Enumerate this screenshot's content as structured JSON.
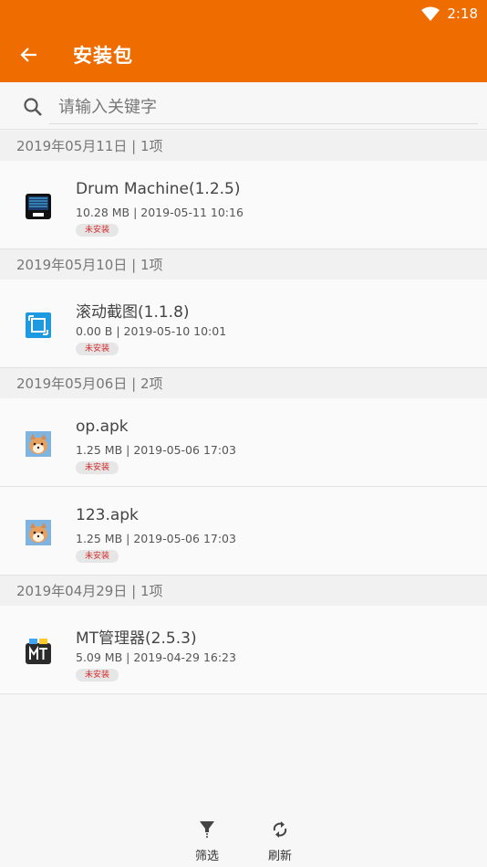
{
  "status": {
    "time": "2:18"
  },
  "toolbar": {
    "title": "安装包"
  },
  "search": {
    "placeholder": "请输入关键字",
    "value": ""
  },
  "groups": [
    {
      "header": "2019年05月11日 | 1项",
      "items": [
        {
          "name": "Drum Machine(1.2.5)",
          "meta": "10.28 MB | 2019-05-11 10:16",
          "badge": "未安装",
          "icon": "drum-machine-app-icon"
        }
      ]
    },
    {
      "header": "2019年05月10日 | 1项",
      "items": [
        {
          "name": "滚动截图(1.1.8)",
          "meta": "0.00 B | 2019-05-10 10:01",
          "badge": "未安装",
          "icon": "scroll-screenshot-app-icon"
        }
      ]
    },
    {
      "header": "2019年05月06日 | 2项",
      "items": [
        {
          "name": "op.apk",
          "meta": "1.25 MB | 2019-05-06 17:03",
          "badge": "未安装",
          "icon": "shiba-dog-app-icon"
        },
        {
          "name": "123.apk",
          "meta": "1.25 MB | 2019-05-06 17:03",
          "badge": "未安装",
          "icon": "shiba-dog-app-icon"
        }
      ]
    },
    {
      "header": "2019年04月29日 | 1项",
      "items": [
        {
          "name": "MT管理器(2.5.3)",
          "meta": "5.09 MB | 2019-04-29 16:23",
          "badge": "未安装",
          "icon": "mt-manager-app-icon"
        }
      ]
    }
  ],
  "bottom": {
    "filter_label": "筛选",
    "refresh_label": "刷新"
  },
  "colors": {
    "accent": "#ef6c00",
    "badge_text": "#d32f2f"
  }
}
